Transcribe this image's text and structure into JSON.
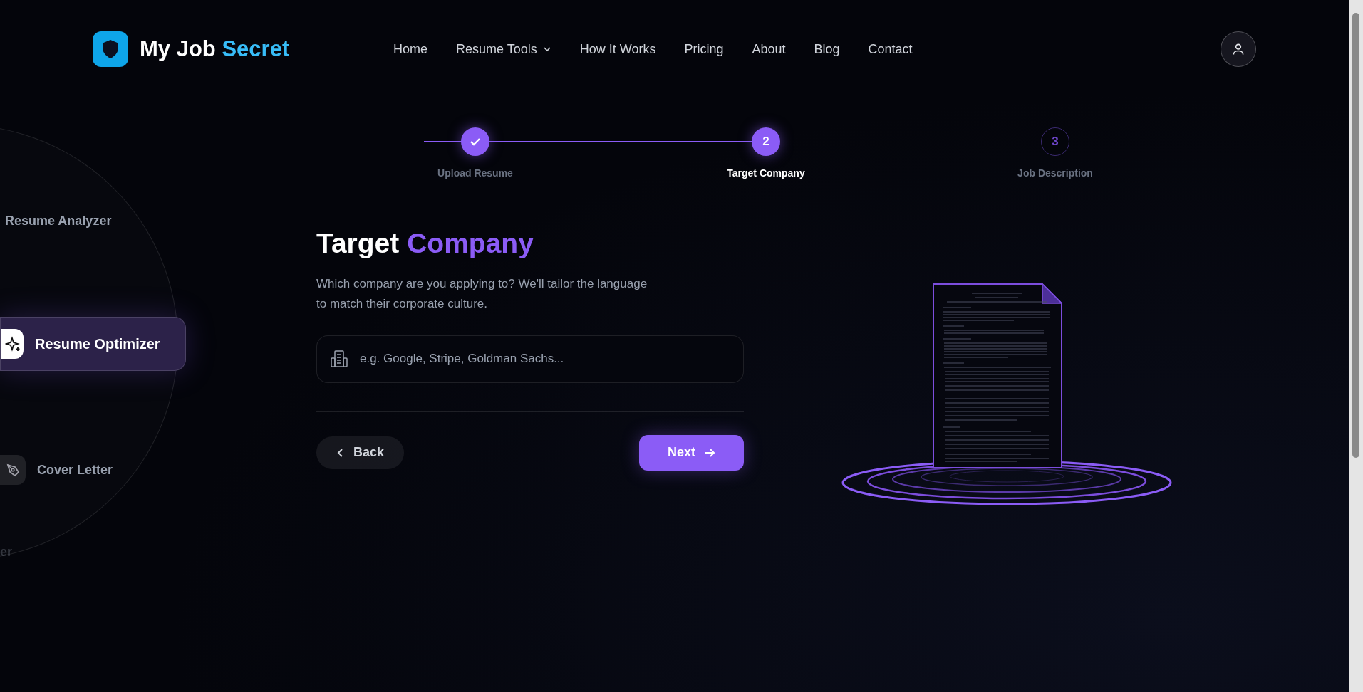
{
  "brand": {
    "parts": [
      {
        "text": "My Job",
        "accent": false
      },
      {
        "text": "Secret",
        "accent": true
      }
    ]
  },
  "nav": [
    {
      "label": "Home",
      "dropdown": false
    },
    {
      "label": "Resume Tools",
      "dropdown": true
    },
    {
      "label": "How It Works",
      "dropdown": false
    },
    {
      "label": "Pricing",
      "dropdown": false
    },
    {
      "label": "About",
      "dropdown": false
    },
    {
      "label": "Blog",
      "dropdown": false
    },
    {
      "label": "Contact",
      "dropdown": false
    }
  ],
  "tool_wheel": [
    {
      "label": "Resume Analyzer",
      "selected": false,
      "kind": "plain"
    },
    {
      "label": "Resume Optimizer",
      "selected": true,
      "kind": "sparkles"
    },
    {
      "label": "Cover Letter",
      "selected": false,
      "kind": "pen"
    },
    {
      "label": "er",
      "selected": false,
      "kind": "plain"
    }
  ],
  "stepper": [
    {
      "kind": "done",
      "label": "Upload Resume"
    },
    {
      "kind": "current",
      "number": "2",
      "label": "Target Company"
    },
    {
      "kind": "upcoming",
      "number": "3",
      "label": "Job Description"
    }
  ],
  "form": {
    "title_parts": [
      {
        "text": "Target",
        "accent": false
      },
      {
        "text": "Company",
        "accent": true
      }
    ],
    "description": "Which company are you applying to? We'll tailor the language to match their corporate culture.",
    "company_field": {
      "placeholder": "e.g. Google, Stripe, Goldman Sachs..."
    },
    "back_button": "Back",
    "next_button": "Next"
  }
}
